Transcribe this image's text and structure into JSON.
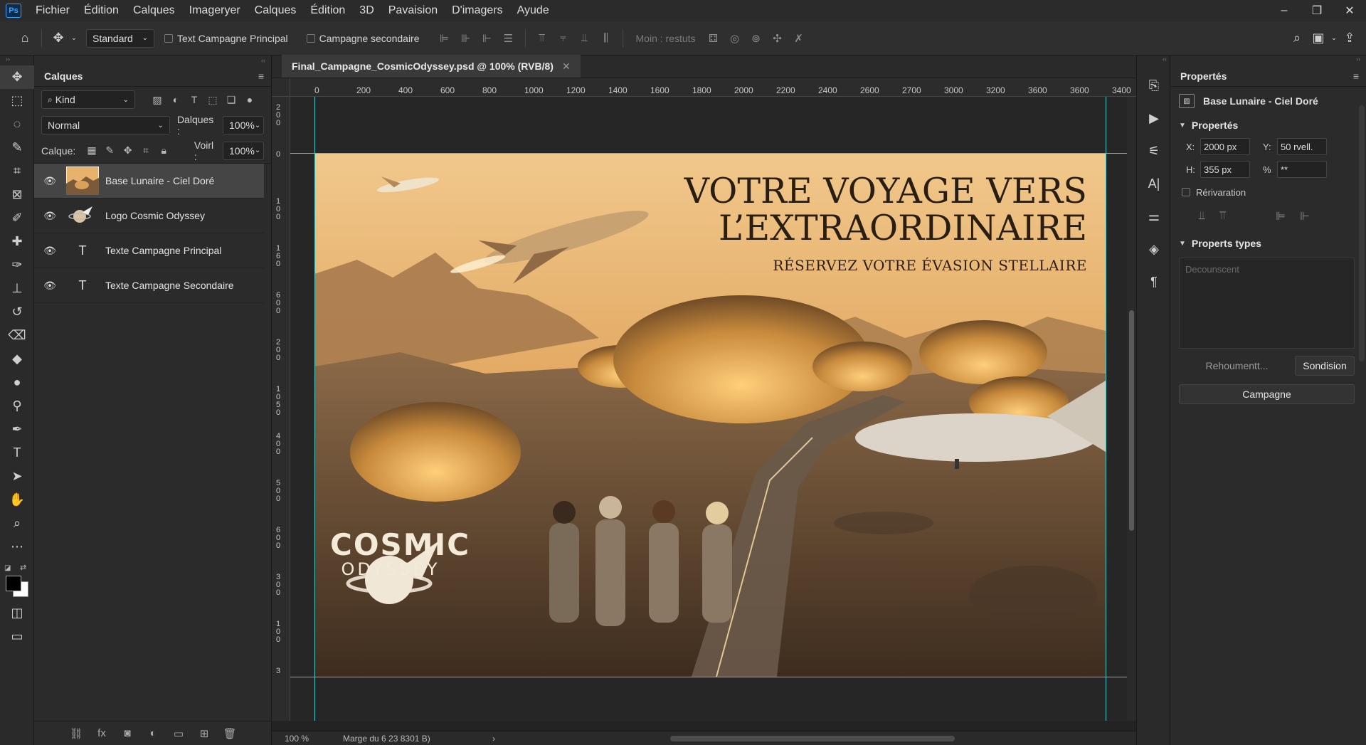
{
  "app": {
    "logo": "Ps"
  },
  "menu": [
    "Fichier",
    "Édition",
    "Calques",
    "Imageryer",
    "Calques",
    "Édition",
    "3D",
    "Pavaision",
    "D'imagers",
    "Ayude"
  ],
  "options": {
    "mode": "Standard",
    "checkbox_1": "Text Campagne Principal",
    "checkbox_2": "Campagne secondaire",
    "muted_label": "Moin : restuts"
  },
  "layers_panel": {
    "title": "Calques",
    "filter_kind": "Kind",
    "blend_mode": "Normal",
    "opacity_label": "Dalques :",
    "opacity_value": "100%",
    "lock_label": "Calque:",
    "fill_label": "Voirl :",
    "fill_value": "100%",
    "layers": [
      {
        "name": "Base Lunaire - Ciel Doré",
        "type": "image",
        "selected": true
      },
      {
        "name": "Logo Cosmic Odyssey",
        "type": "smart",
        "selected": false
      },
      {
        "name": "Texte Campagne Principal",
        "type": "text",
        "selected": false
      },
      {
        "name": "Texte Campagne Secondaire",
        "type": "text",
        "selected": false
      }
    ]
  },
  "document": {
    "tab_title": "Final_Campagne_CosmicOdyssey.psd @ 100% (RVB/8)",
    "ruler_h": [
      "0",
      "200",
      "400",
      "600",
      "800",
      "1000",
      "1200",
      "1400",
      "1600",
      "1800",
      "2000",
      "2200",
      "2400",
      "2600",
      "2700",
      "3000",
      "3200",
      "3600",
      "3600",
      "3400"
    ],
    "ruler_v": [
      "200",
      "0",
      "100",
      "160",
      "600",
      "200",
      "1050",
      "400",
      "500",
      "600",
      "300",
      "100",
      "3"
    ],
    "headline_1": "VOTRE VOYAGE VERS",
    "headline_2": "L’EXTRAORDINAIRE",
    "subline": "RÉSERVEZ VOTRE ÉVASION STELLAIRE",
    "brand_1": "COSMIC",
    "brand_2": "ODYSSEY",
    "zoom": "100 %",
    "status": "Marge du 6 23 8301 B)"
  },
  "properties": {
    "title": "Propertés",
    "layer_name": "Base Lunaire - Ciel Doré",
    "section_1": "Propertés",
    "x_label": "X:",
    "x_value": "2000 px",
    "y_label": "Y:",
    "y_value": "50 rvell.",
    "h_label": "H:",
    "h_value": "355 px",
    "pct_label": "%",
    "pct_value": "**",
    "checkbox": "Rérivaration",
    "section_2": "Properts types",
    "textarea_placeholder": "Decounscent",
    "btn_left": "Rehoumentt...",
    "btn_right": "Sondision",
    "btn_wide": "Campagne"
  },
  "colors": {
    "accent": "#31a8ff",
    "guide": "#4cc7c7",
    "sky": "#e8b06a"
  }
}
